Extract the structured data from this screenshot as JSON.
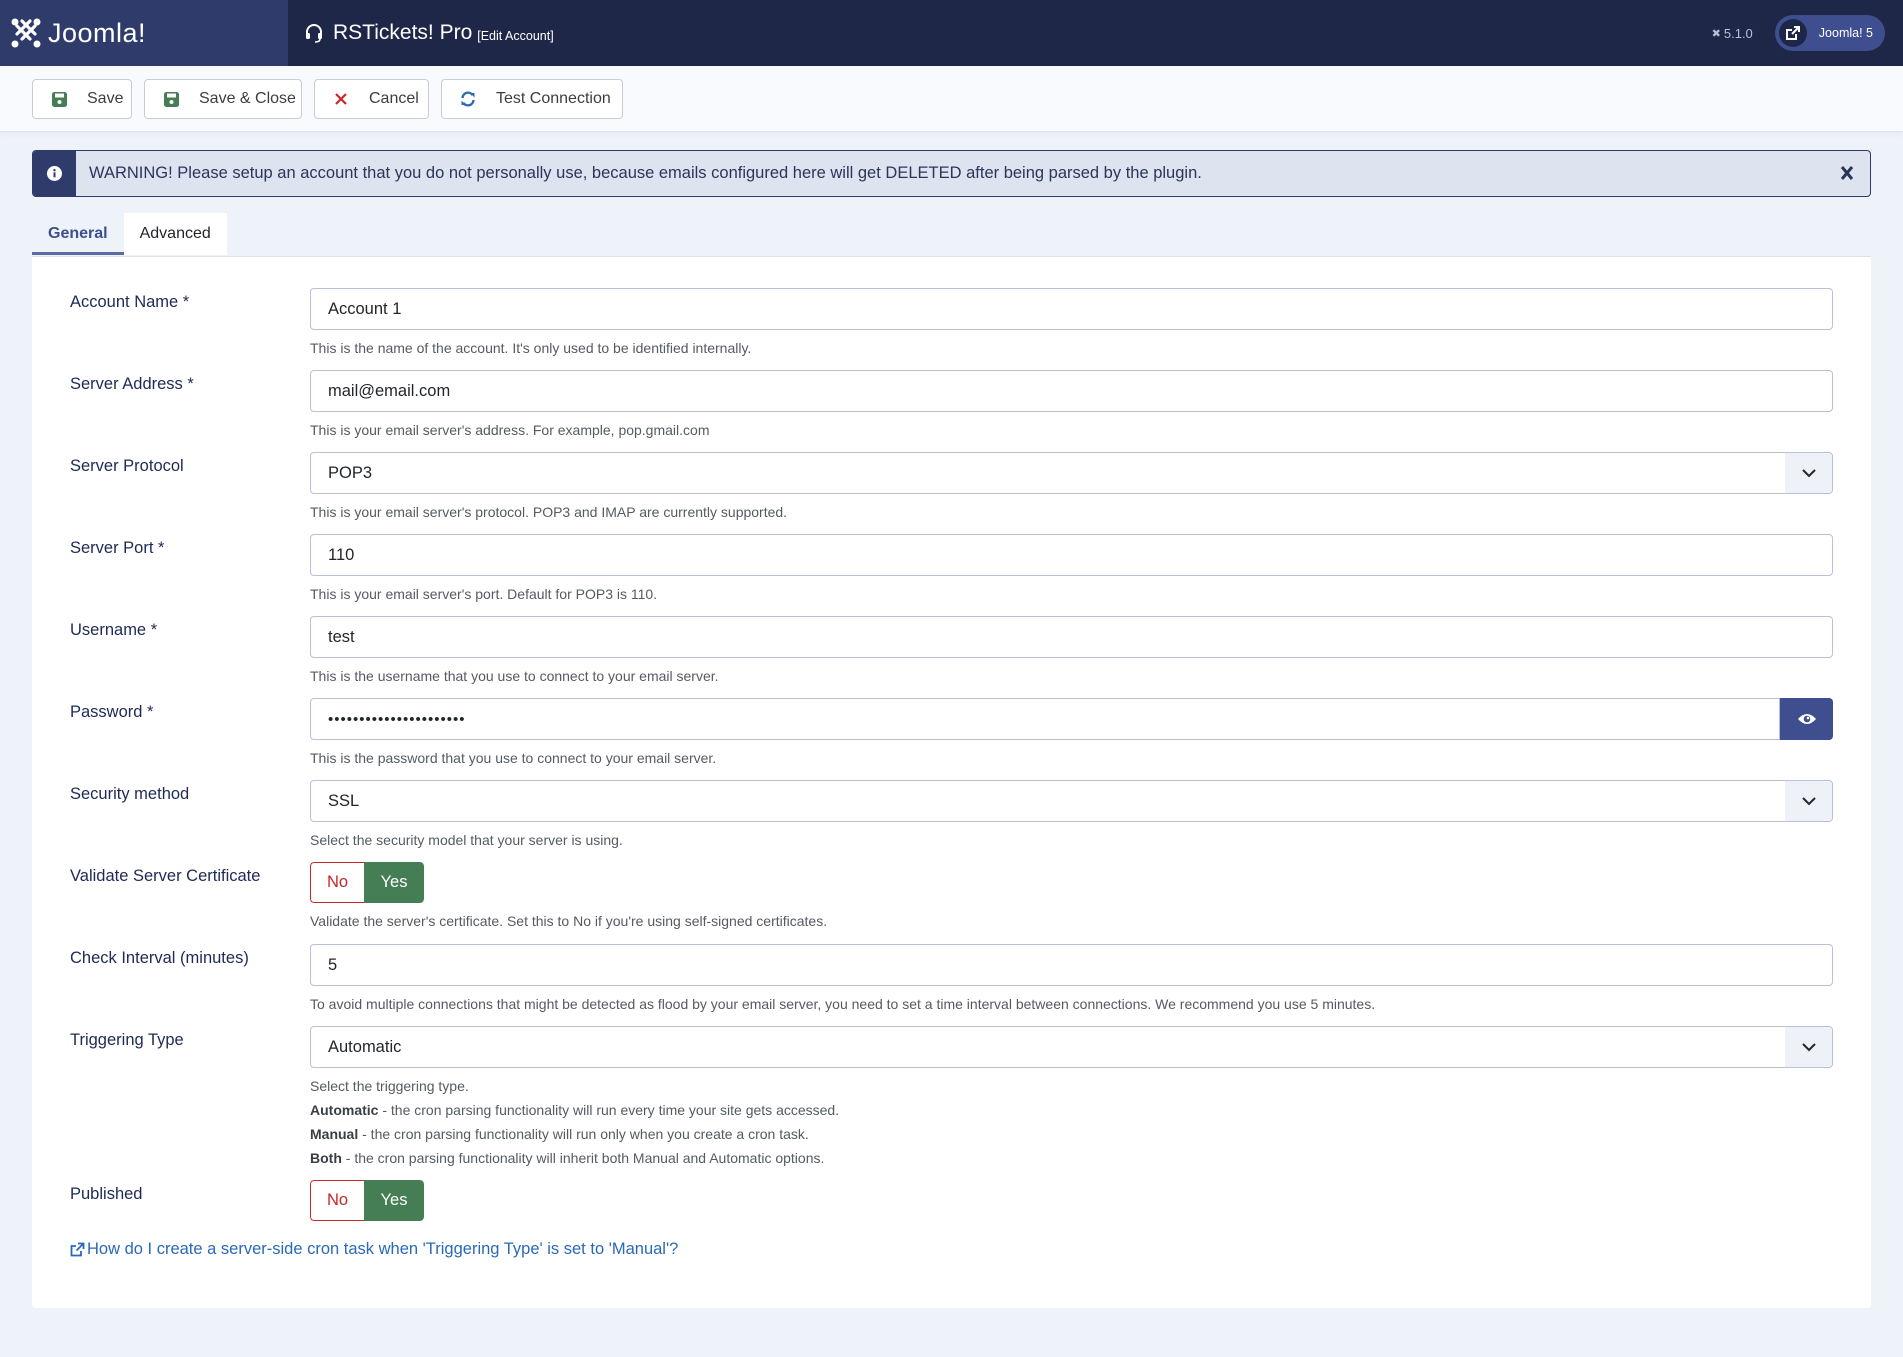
{
  "header": {
    "brand": "Joomla!",
    "app_title": "RSTickets! Pro",
    "app_subtitle": "[Edit Account]",
    "version": "5.1.0",
    "site_button": "Joomla! 5"
  },
  "toolbar": {
    "save": "Save",
    "save_close": "Save & Close",
    "cancel": "Cancel",
    "test_connection": "Test Connection"
  },
  "alert": {
    "text": "WARNING! Please setup an account that you do not personally use, because emails configured here will get DELETED after being parsed by the plugin.",
    "close": "✕"
  },
  "tabs": [
    {
      "label": "General",
      "active": true
    },
    {
      "label": "Advanced",
      "active": false
    }
  ],
  "form": {
    "account_name": {
      "label": "Account Name *",
      "value": "Account 1",
      "help": "This is the name of the account. It's only used to be identified internally."
    },
    "server_address": {
      "label": "Server Address *",
      "value": "mail@email.com",
      "help": "This is your email server's address. For example, pop.gmail.com"
    },
    "server_protocol": {
      "label": "Server Protocol",
      "value": "POP3",
      "help": "This is your email server's protocol. POP3 and IMAP are currently supported."
    },
    "server_port": {
      "label": "Server Port *",
      "value": "110",
      "help": "This is your email server's port. Default for POP3 is 110."
    },
    "username": {
      "label": "Username *",
      "value": "test",
      "help": "This is the username that you use to connect to your email server."
    },
    "password": {
      "label": "Password *",
      "value": "••••••••••••••••••••••",
      "help": "This is the password that you use to connect to your email server."
    },
    "security_method": {
      "label": "Security method",
      "value": "SSL",
      "help": "Select the security model that your server is using."
    },
    "validate_cert": {
      "label": "Validate Server Certificate",
      "no": "No",
      "yes": "Yes",
      "selected": "Yes",
      "help": "Validate the server's certificate. Set this to No if you're using self-signed certificates."
    },
    "check_interval": {
      "label": "Check Interval (minutes)",
      "value": "5",
      "help": "To avoid multiple connections that might be detected as flood by your email server, you need to set a time interval between connections. We recommend you use 5 minutes."
    },
    "triggering_type": {
      "label": "Triggering Type",
      "value": "Automatic",
      "help": "Select the triggering type.",
      "options_help": [
        {
          "term": "Automatic",
          "desc": " - the cron parsing functionality will run every time your site gets accessed."
        },
        {
          "term": "Manual",
          "desc": " - the cron parsing functionality will run only when you create a cron task."
        },
        {
          "term": "Both",
          "desc": " - the cron parsing functionality will inherit both Manual and Automatic options."
        }
      ]
    },
    "published": {
      "label": "Published",
      "no": "No",
      "yes": "Yes",
      "selected": "Yes"
    }
  },
  "cron_link": "How do I create a server-side cron task when 'Triggering Type' is set to 'Manual'?",
  "colors": {
    "header": "#1f2748",
    "logo_bg": "#2f3b6b",
    "accent": "#3e4e8f",
    "yes_green": "#457d54",
    "no_red": "#c52827",
    "link": "#2a69b8"
  }
}
